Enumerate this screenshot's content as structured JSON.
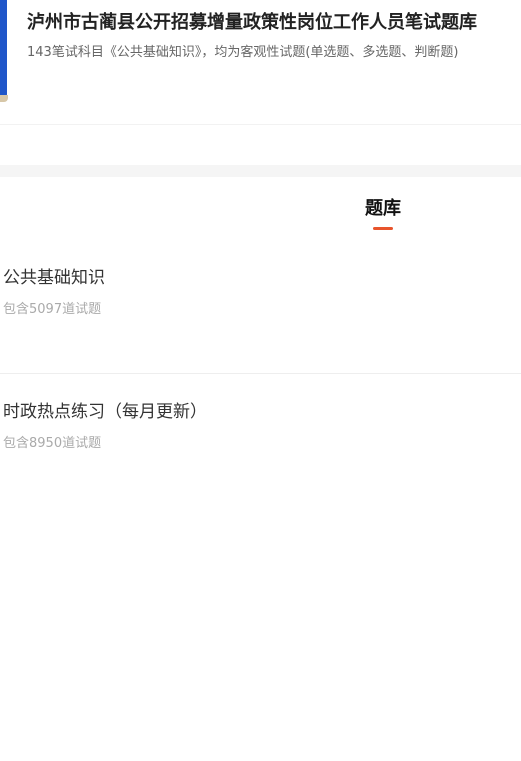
{
  "exam": {
    "title": "泸州市古蔺县公开招募增量政策性岗位工作人员笔试题库",
    "description": "143笔试科目《公共基础知识》，均为客观性试题(单选题、多选题、判断题)"
  },
  "tabs": [
    {
      "label": "题库"
    }
  ],
  "banks": [
    {
      "name": "公共基础知识",
      "count": "包含5097道试题"
    },
    {
      "name": "时政热点练习（每月更新）",
      "count": "包含8950道试题"
    }
  ],
  "colors": {
    "accent": "#e8542c",
    "cover": "#1f56c9"
  }
}
